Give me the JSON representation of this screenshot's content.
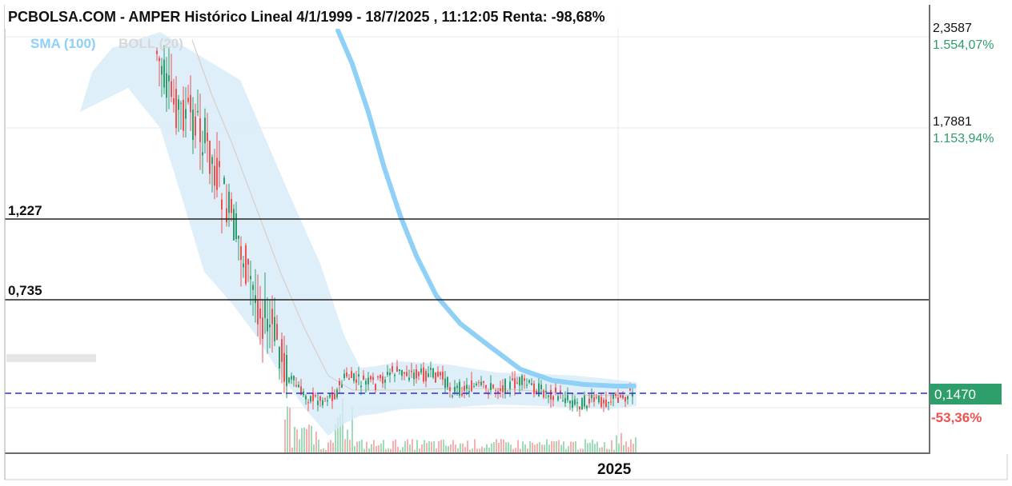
{
  "header": {
    "title": "PCBOLSA.COM - AMPER Histórico Lineal 4/1/1999 - 18/7/2025 , 11:12:05 Renta: -98,68%"
  },
  "legend": {
    "sma": "SMA (100)",
    "boll": "BOLL (20)"
  },
  "colors": {
    "up": "#2e9e6a",
    "down": "#f05050",
    "sma": "#8fd0f7",
    "band": "#d6ebf9",
    "last_line": "#2d2de0",
    "last_badge": "#2e9e6a",
    "level_line": "#222222",
    "grid": "#e8e8e8"
  },
  "chart_data": {
    "type": "candlestick",
    "title": "PCBOLSA.COM - AMPER Histórico Lineal 4/1/1999 - 18/7/2025 , 11:12:05 Renta: -98,68%",
    "x_labels": [
      "2025"
    ],
    "y_ticks": [
      {
        "value": "2,3587",
        "pct": "1.554,07%"
      },
      {
        "value": "1,7881",
        "pct": "1.153,94%"
      }
    ],
    "levels": [
      {
        "label": "1,227",
        "value": 1.227
      },
      {
        "label": "0,735",
        "value": 0.735
      }
    ],
    "last": {
      "label": "0,1470",
      "value": 0.147,
      "change": "-53,36%"
    },
    "grid": true
  }
}
